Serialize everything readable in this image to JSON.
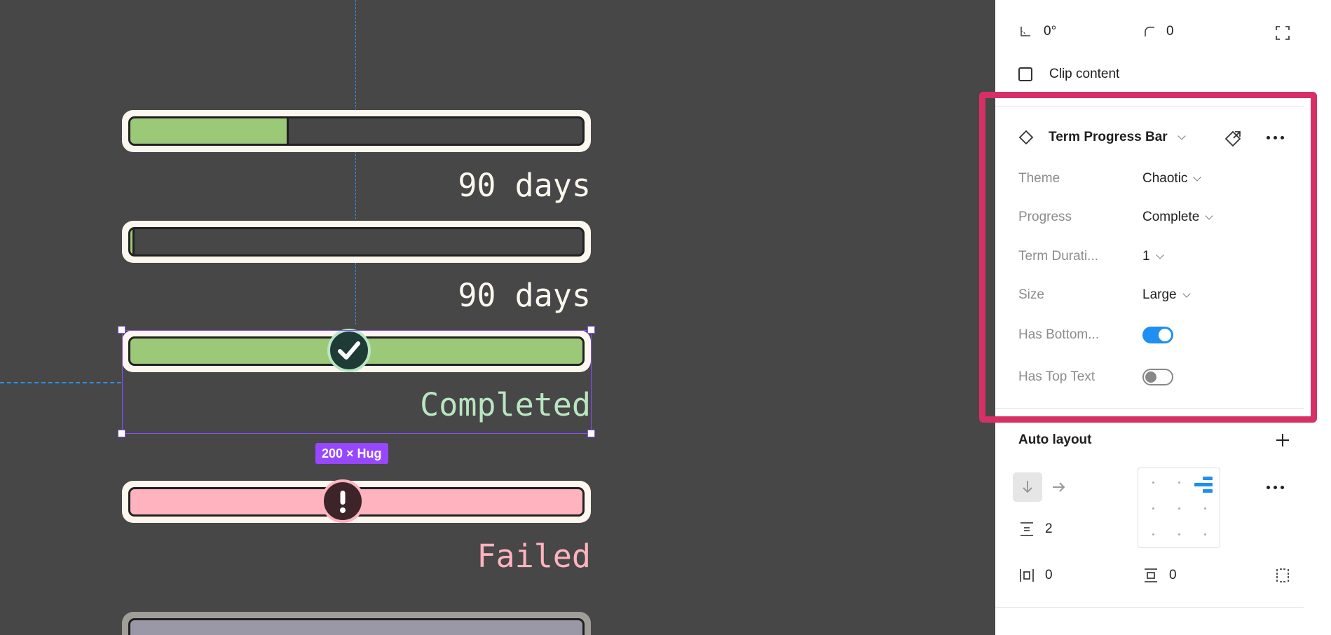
{
  "canvas": {
    "bars": [
      {
        "label": "90 days",
        "progress": 0.35,
        "state": "in-progress"
      },
      {
        "label": "90 days",
        "progress": 0.01,
        "state": "started"
      },
      {
        "label": "Completed",
        "progress": 1.0,
        "state": "completed",
        "status_icon": "check-circle-icon"
      },
      {
        "label": "Failed",
        "progress": 1.0,
        "state": "failed",
        "status_icon": "alert-circle-icon"
      }
    ],
    "selection_size": "200 × Hug",
    "colors": {
      "background": "#474747",
      "bar_frame": "#fbf7ef",
      "fill_green": "#9cc978",
      "fill_pink": "#ffb3bf",
      "completed_text": "#b9e6c2",
      "failed_text": "#ffb3bf",
      "selection": "#9747ff",
      "guide": "#2f8fe6"
    }
  },
  "panel": {
    "rotation": "0°",
    "corner_radius": "0",
    "clip_content_label": "Clip content",
    "clip_content_checked": false,
    "component": {
      "name": "Term Progress Bar",
      "icon": "component-diamond-icon",
      "properties": [
        {
          "label": "Theme",
          "value": "Chaotic",
          "type": "dropdown"
        },
        {
          "label": "Progress",
          "value": "Complete",
          "type": "dropdown"
        },
        {
          "label": "Term Durati...",
          "value": "1",
          "type": "dropdown"
        },
        {
          "label": "Size",
          "value": "Large",
          "type": "dropdown"
        },
        {
          "label": "Has Bottom...",
          "value": "on",
          "type": "toggle"
        },
        {
          "label": "Has Top Text",
          "value": "off",
          "type": "toggle"
        }
      ]
    },
    "auto_layout": {
      "title": "Auto layout",
      "gap": "2",
      "padding_horizontal": "0",
      "padding_vertical": "0"
    },
    "highlight_color": "#d63066",
    "toggle_on_color": "#1f8ff2"
  }
}
